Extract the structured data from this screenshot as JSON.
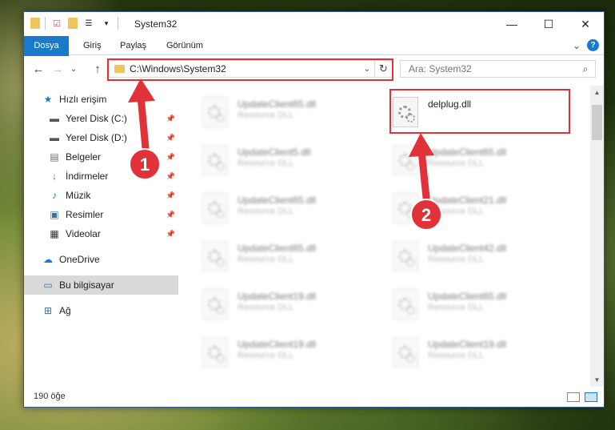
{
  "titlebar": {
    "title": "System32",
    "min": "—",
    "max": "☐",
    "close": "✕"
  },
  "ribbon": {
    "tabs": [
      "Dosya",
      "Giriş",
      "Paylaş",
      "Görünüm"
    ],
    "expand": "⌄",
    "help": "?"
  },
  "nav": {
    "back": "←",
    "forward": "→",
    "recent": "⌄",
    "up": "↑",
    "address": "C:\\Windows\\System32",
    "address_chevron": "⌄",
    "refresh": "↻",
    "search_placeholder": "Ara: System32",
    "search_icon": "⌕"
  },
  "sidebar": {
    "items": [
      {
        "label": "Hızlı erişim",
        "icon": "star-icon",
        "pinned": false
      },
      {
        "label": "Yerel Disk (C:)",
        "icon": "drive-icon",
        "pinned": true
      },
      {
        "label": "Yerel Disk (D:)",
        "icon": "drive-icon",
        "pinned": true
      },
      {
        "label": "Belgeler",
        "icon": "document-icon",
        "pinned": true
      },
      {
        "label": "İndirmeler",
        "icon": "download-icon",
        "pinned": true
      },
      {
        "label": "Müzik",
        "icon": "music-icon",
        "pinned": true
      },
      {
        "label": "Resimler",
        "icon": "picture-icon",
        "pinned": true
      },
      {
        "label": "Videolar",
        "icon": "video-icon",
        "pinned": true
      },
      {
        "label": "OneDrive",
        "icon": "cloud-icon",
        "pinned": false
      },
      {
        "label": "Bu bilgisayar",
        "icon": "computer-icon",
        "pinned": false,
        "selected": true
      },
      {
        "label": "Ağ",
        "icon": "network-icon",
        "pinned": false
      }
    ]
  },
  "files": [
    {
      "name": "UpdateClient65.dll",
      "type": "Resource DLL",
      "blurred": true
    },
    {
      "name": "delplug.dll",
      "type": "",
      "blurred": false,
      "highlighted": true
    },
    {
      "name": "UpdateClient5.dll",
      "type": "Resource DLL",
      "blurred": true
    },
    {
      "name": "UpdateClient65.dll",
      "type": "Resource DLL",
      "blurred": true
    },
    {
      "name": "UpdateClient65.dll",
      "type": "Resource DLL",
      "blurred": true
    },
    {
      "name": "UpdateClient21.dll",
      "type": "Resource DLL",
      "blurred": true
    },
    {
      "name": "UpdateClient65.dll",
      "type": "Resource DLL",
      "blurred": true
    },
    {
      "name": "UpdateClient42.dll",
      "type": "Resource DLL",
      "blurred": true
    },
    {
      "name": "UpdateClient19.dll",
      "type": "Resource DLL",
      "blurred": true
    },
    {
      "name": "UpdateClient65.dll",
      "type": "Resource DLL",
      "blurred": true
    },
    {
      "name": "UpdateClient19.dll",
      "type": "Resource DLL",
      "blurred": true
    },
    {
      "name": "UpdateClient19.dll",
      "type": "Resource DLL",
      "blurred": true
    }
  ],
  "status": {
    "count": "190 öğe"
  },
  "annotations": {
    "step1": "1",
    "step2": "2",
    "accent": "#e03238"
  },
  "colors": {
    "file_tab": "#1979ca",
    "folder": "#f2c55c",
    "selected": "#d9d9d9"
  }
}
